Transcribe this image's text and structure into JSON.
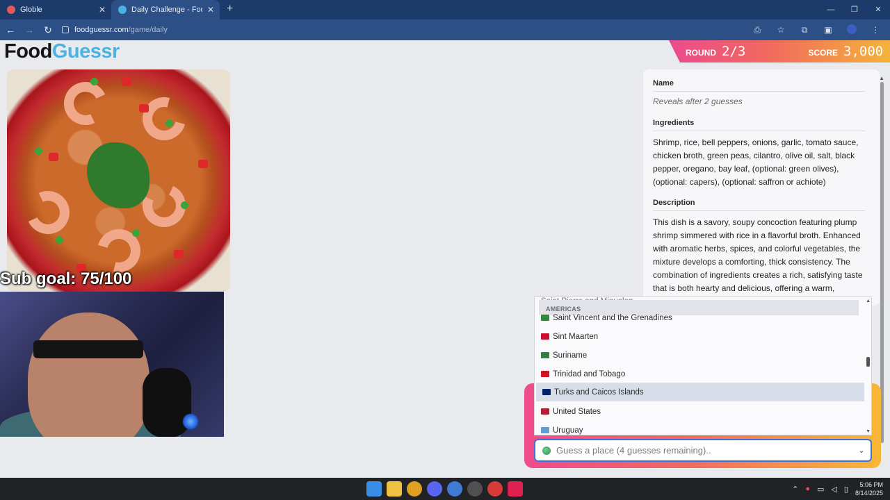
{
  "browser": {
    "tabs": [
      {
        "title": "Globle",
        "icon": "globe-icon",
        "active": false
      },
      {
        "title": "Daily Challenge - FoodGuessr |",
        "icon": "foodguessr-icon",
        "active": true
      }
    ],
    "new_tab": "+",
    "url_domain": "foodguessr.com",
    "url_path": "/game/daily"
  },
  "logo": {
    "part1": "Food",
    "part2": "Guessr"
  },
  "overlay": {
    "sub_goal": "Sub goal: 75/100"
  },
  "banner": {
    "round_label": "ROUND",
    "round_value": "2/3",
    "score_label": "SCORE",
    "score_value": "3,000"
  },
  "panel": {
    "name_header": "Name",
    "name_value": "Reveals after 2 guesses",
    "ingredients_header": "Ingredients",
    "ingredients": "Shrimp, rice, bell peppers, onions, garlic, tomato sauce, chicken broth, green peas, cilantro, olive oil, salt, black pepper, oregano, bay leaf, (optional: green olives), (optional: capers), (optional: saffron or achiote)",
    "description_header": "Description",
    "description": "This dish is a savory, soupy concoction featuring plump shrimp simmered with rice in a flavorful broth. Enhanced with aromatic herbs, spices, and colorful vegetables, the mixture develops a comforting, thick consistency. The combination of ingredients creates a rich, satisfying taste that is both hearty and delicious, offering a warm, comforting meal that is perfect for any gathering or cozy night in."
  },
  "dropdown": {
    "partial_item": "Saint Pierre and Miquelon",
    "group": "AMERICAS",
    "items": [
      {
        "label": "Saint Vincent and the Grenadines",
        "flag_color": "#2e8b3a"
      },
      {
        "label": "Sint Maarten",
        "flag_color": "#c8102e"
      },
      {
        "label": "Suriname",
        "flag_color": "#377e3f"
      },
      {
        "label": "Trinidad and Tobago",
        "flag_color": "#ce1126"
      },
      {
        "label": "Turks and Caicos Islands",
        "flag_color": "#012169"
      },
      {
        "label": "United States",
        "flag_color": "#b22234"
      },
      {
        "label": "Uruguay",
        "flag_color": "#5aa0d8"
      }
    ],
    "highlighted_index": 4
  },
  "guess": {
    "placeholder": "Guess a place (4 guesses remaining).."
  },
  "taskbar": {
    "time": "5:06 PM",
    "date": "8/14/2025"
  },
  "colors": {
    "accent_blue": "#4ab3e4",
    "banner_pink": "#ea4b8e",
    "banner_orange": "#f5b33a"
  }
}
